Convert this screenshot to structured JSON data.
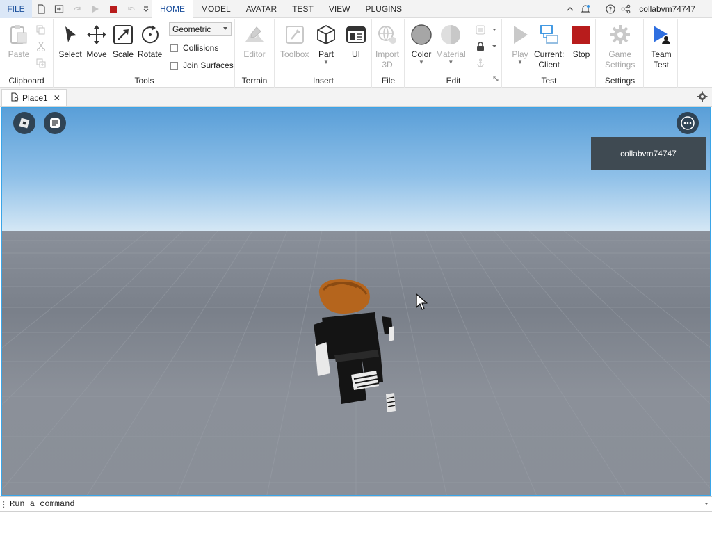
{
  "menubar": {
    "file_label": "FILE",
    "tabs": [
      {
        "label": "HOME",
        "active": true
      },
      {
        "label": "MODEL",
        "active": false
      },
      {
        "label": "AVATAR",
        "active": false
      },
      {
        "label": "TEST",
        "active": false
      },
      {
        "label": "VIEW",
        "active": false
      },
      {
        "label": "PLUGINS",
        "active": false
      }
    ],
    "username": "collabvm74747"
  },
  "ribbon": {
    "groups": {
      "clipboard": "Clipboard",
      "tools": "Tools",
      "terrain": "Terrain",
      "insert": "Insert",
      "file": "File",
      "edit": "Edit",
      "test": "Test",
      "settings": "Settings"
    },
    "paste": "Paste",
    "select": "Select",
    "move": "Move",
    "scale": "Scale",
    "rotate": "Rotate",
    "mode_dropdown": "Geometric",
    "collisions": "Collisions",
    "join_surfaces": "Join Surfaces",
    "editor": "Editor",
    "toolbox": "Toolbox",
    "part": "Part",
    "ui": "UI",
    "import3d_line1": "Import",
    "import3d_line2": "3D",
    "color": "Color",
    "material": "Material",
    "play": "Play",
    "current_line1": "Current:",
    "current_line2": "Client",
    "stop": "Stop",
    "game_settings_line1": "Game",
    "game_settings_line2": "Settings",
    "team_test_line1": "Team",
    "team_test_line2": "Test"
  },
  "doc_tab": {
    "label": "Place1",
    "close": "✕"
  },
  "viewport": {
    "player_name": "collabvm74747"
  },
  "command_bar": {
    "placeholder": "Run a command"
  },
  "colors": {
    "accent": "#3aa5e8",
    "file_bg": "#dbe7f7",
    "stop_red": "#b81c1c",
    "play_gray": "#c9c9c9",
    "team_test_blue": "#2f6fe0"
  }
}
